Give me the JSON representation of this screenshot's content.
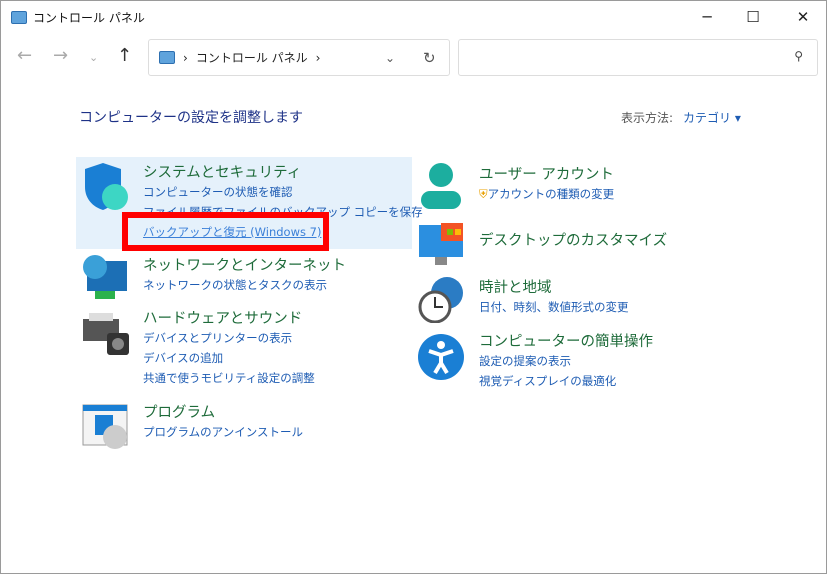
{
  "window": {
    "title": "コントロール パネル"
  },
  "address": {
    "path": "コントロール パネル",
    "sep": "›"
  },
  "search": {
    "placeholder": ""
  },
  "main": {
    "heading": "コンピューターの設定を調整します",
    "view_label": "表示方法:",
    "view_value": "カテゴリ ▾"
  },
  "categories": [
    {
      "title": "システムとセキュリティ",
      "links": [
        "コンピューターの状態を確認",
        "ファイル履歴でファイルのバックアップ コピーを保存",
        "バックアップと復元 (Windows 7)"
      ]
    },
    {
      "title": "ネットワークとインターネット",
      "links": [
        "ネットワークの状態とタスクの表示"
      ]
    },
    {
      "title": "ハードウェアとサウンド",
      "links": [
        "デバイスとプリンターの表示",
        "デバイスの追加",
        "共通で使うモビリティ設定の調整"
      ]
    },
    {
      "title": "プログラム",
      "links": [
        "プログラムのアンインストール"
      ]
    },
    {
      "title": "ユーザー アカウント",
      "links": [
        "アカウントの種類の変更"
      ]
    },
    {
      "title": "デスクトップのカスタマイズ",
      "links": []
    },
    {
      "title": "時計と地域",
      "links": [
        "日付、時刻、数値形式の変更"
      ]
    },
    {
      "title": "コンピューターの簡単操作",
      "links": [
        "設定の提案の表示",
        "視覚ディスプレイの最適化"
      ]
    }
  ]
}
